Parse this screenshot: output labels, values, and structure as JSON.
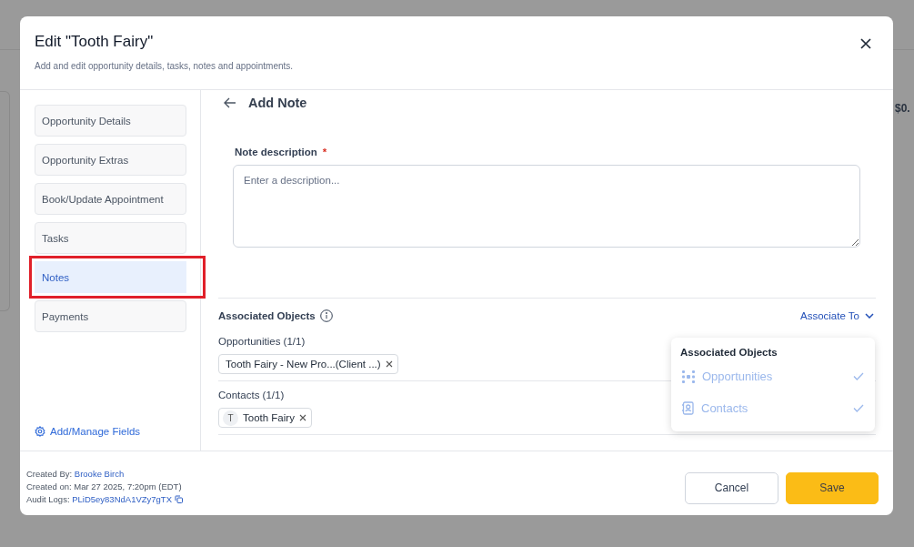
{
  "background": {
    "amount": "$0."
  },
  "modal": {
    "title": "Edit \"Tooth Fairy\"",
    "subtitle": "Add and edit opportunity details, tasks, notes and appointments."
  },
  "sidebar": {
    "items": [
      {
        "label": "Opportunity Details",
        "selected": false,
        "highlighted": false
      },
      {
        "label": "Opportunity Extras",
        "selected": false,
        "highlighted": false
      },
      {
        "label": "Book/Update Appointment",
        "selected": false,
        "highlighted": false
      },
      {
        "label": "Tasks",
        "selected": false,
        "highlighted": false
      },
      {
        "label": "Notes",
        "selected": true,
        "highlighted": true
      },
      {
        "label": "Payments",
        "selected": false,
        "highlighted": false
      }
    ],
    "footer_link": "Add/Manage Fields"
  },
  "panel": {
    "title": "Add Note",
    "note_field": {
      "label": "Note description",
      "required_mark": "*",
      "placeholder": "Enter a description..."
    },
    "associated": {
      "title": "Associated Objects",
      "associate_button": "Associate To",
      "groups": [
        {
          "label": "Opportunities (1/1)",
          "chips": [
            {
              "kind": "record",
              "label": "Tooth Fairy - New Pro...(Client ...)"
            }
          ]
        },
        {
          "label": "Contacts (1/1)",
          "chips": [
            {
              "kind": "contact",
              "initial": "T",
              "label": "Tooth Fairy"
            }
          ]
        }
      ]
    }
  },
  "dropdown": {
    "title": "Associated Objects",
    "items": [
      {
        "kind": "opportunities",
        "label": "Opportunities",
        "checked": true
      },
      {
        "kind": "contacts",
        "label": "Contacts",
        "checked": true
      }
    ]
  },
  "footer": {
    "meta": [
      {
        "kind": "link",
        "label": "Created By:",
        "value": "Brooke Birch"
      },
      {
        "kind": "text",
        "label": "Created on:",
        "value": "Mar 27 2025, 7:20pm (EDT)"
      },
      {
        "kind": "copy",
        "label": "Audit Logs:",
        "value": "PLiD5ey83NdA1VZy7gTX"
      }
    ],
    "buttons": [
      {
        "kind": "secondary",
        "label": "Cancel"
      },
      {
        "kind": "primary",
        "label": "Save"
      }
    ]
  }
}
